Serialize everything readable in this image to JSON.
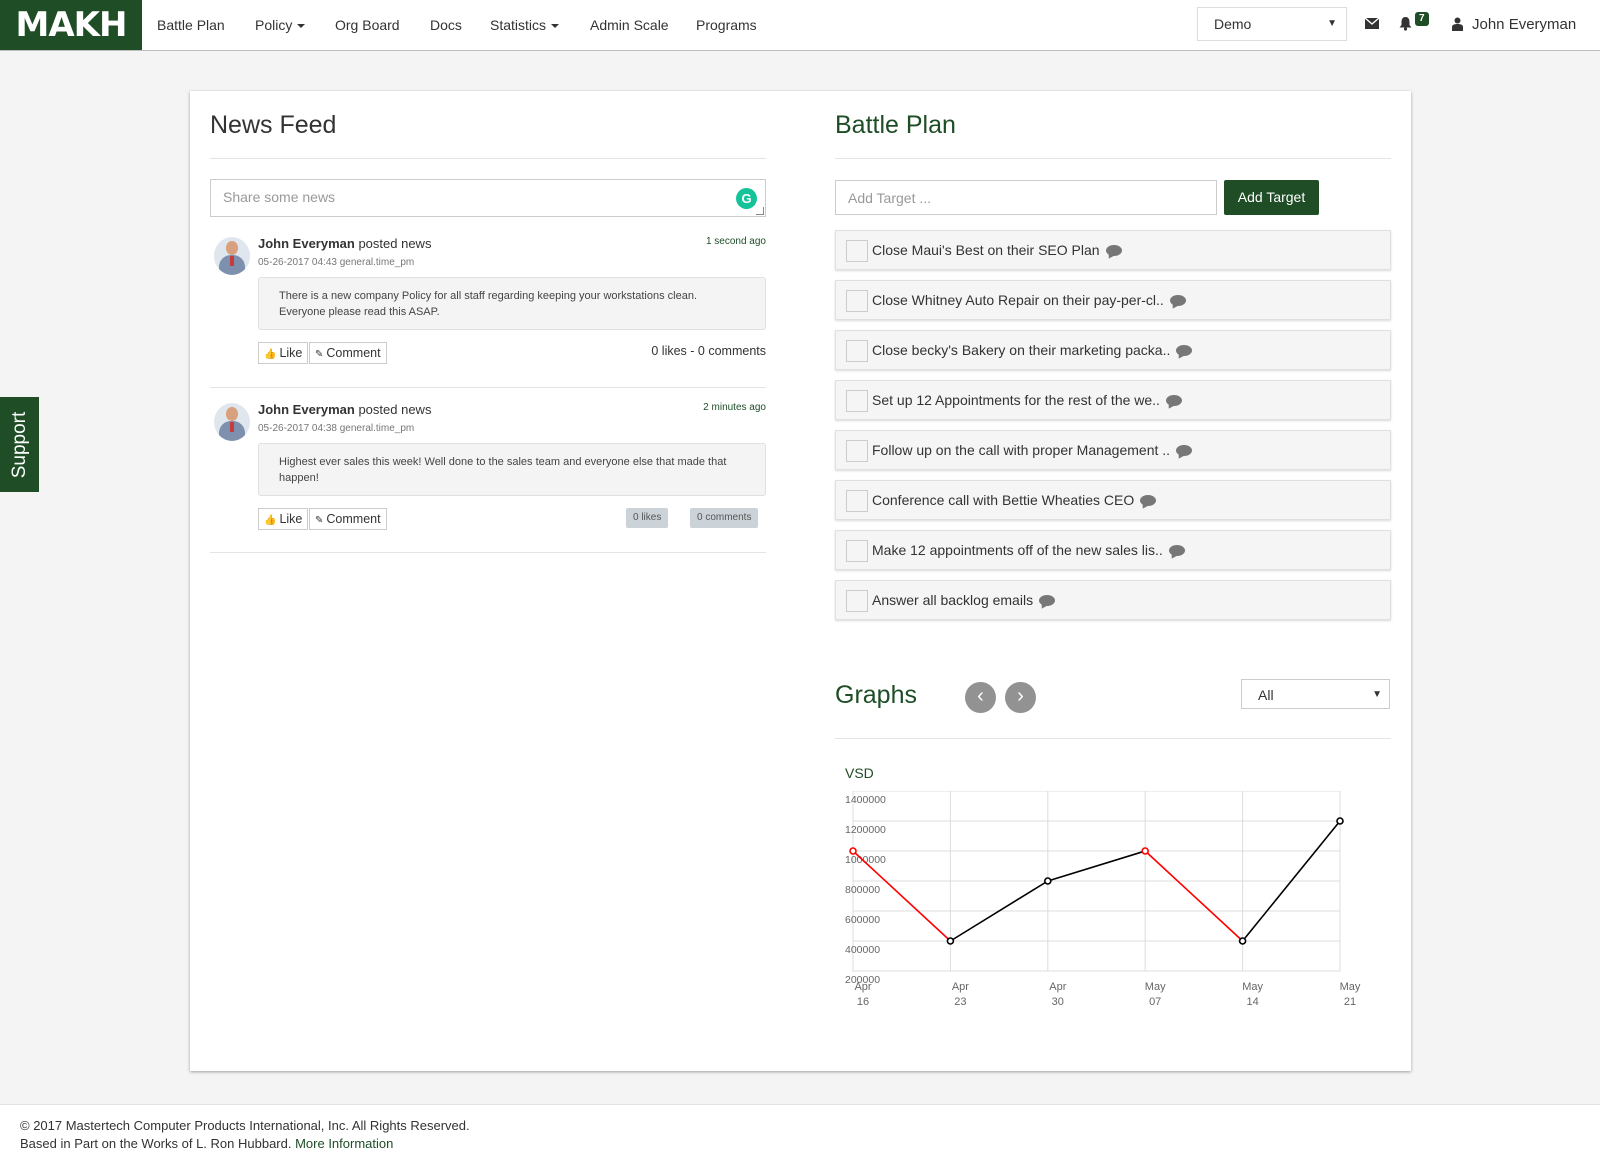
{
  "brand": {
    "logo_text": "MAKH"
  },
  "nav": {
    "items": [
      {
        "label": "Battle Plan",
        "dropdown": false
      },
      {
        "label": "Policy",
        "dropdown": true
      },
      {
        "label": "Org Board",
        "dropdown": false
      },
      {
        "label": "Docs",
        "dropdown": false
      },
      {
        "label": "Statistics",
        "dropdown": true
      },
      {
        "label": "Admin Scale",
        "dropdown": false
      },
      {
        "label": "Programs",
        "dropdown": false
      }
    ],
    "org_select": "Demo",
    "notification_count": "7",
    "user_name": "John Everyman",
    "icons": [
      "envelope-icon",
      "bell-icon",
      "user-icon"
    ]
  },
  "support_tab": "Support",
  "news_feed": {
    "title": "News Feed",
    "share_placeholder": "Share some news",
    "posts": [
      {
        "author": "John Everyman",
        "action": "posted news",
        "date": "05-26-2017 04:43",
        "time_label": "general.time_pm",
        "ago": "1 second ago",
        "body": "There is a new company Policy for all staff regarding keeping your workstations clean. Everyone please read this ASAP.",
        "like_label": "Like",
        "comment_label": "Comment",
        "counts": "0 likes - 0 comments"
      },
      {
        "author": "John Everyman",
        "action": "posted news",
        "date": "05-26-2017 04:38",
        "time_label": "general.time_pm",
        "ago": "2 minutes ago",
        "body": "Highest ever sales this week! Well done to the sales team and everyone else that made that happen!",
        "like_label": "Like",
        "comment_label": "Comment",
        "likes_badge": "0 likes",
        "comments_badge": "0 comments"
      }
    ]
  },
  "battle_plan": {
    "title": "Battle Plan",
    "target_placeholder": "Add Target ...",
    "add_button": "Add Target",
    "targets": [
      "Close Maui's Best on their SEO Plan",
      "Close Whitney Auto Repair on their pay-per-cl..",
      "Close becky's Bakery on their marketing packa..",
      "Set up 12 Appointments for the rest of the we..",
      "Follow up on the call with proper Management ..",
      "Conference call with Bettie Wheaties CEO",
      "Make 12 appointments off of the new sales lis..",
      "Answer all backlog emails"
    ]
  },
  "graphs": {
    "title": "Graphs",
    "prev_label": "‹",
    "next_label": "›",
    "filter_select": "All"
  },
  "chart_data": {
    "type": "line",
    "title": "VSD",
    "x": [
      "Apr 16",
      "Apr 23",
      "Apr 30",
      "May 07",
      "May 14",
      "May 21"
    ],
    "values": [
      1000000,
      400000,
      800000,
      1000000,
      400000,
      1200000
    ],
    "ylim": [
      200000,
      1400000
    ],
    "yticks": [
      1400000,
      1200000,
      1000000,
      800000,
      600000,
      400000,
      200000
    ],
    "grid": true,
    "colors": {
      "down": "#ff0000",
      "up": "#000000",
      "point_fill": "#ffffff"
    }
  },
  "footer": {
    "copyright": "© 2017 Mastertech Computer Products International, Inc. All Rights Reserved.",
    "credit": "Based in Part on the Works of L. Ron Hubbard.",
    "more_link": "More Information"
  },
  "colors": {
    "brand_green": "#1e4d26",
    "badge_gray": "#ccd3d8"
  }
}
